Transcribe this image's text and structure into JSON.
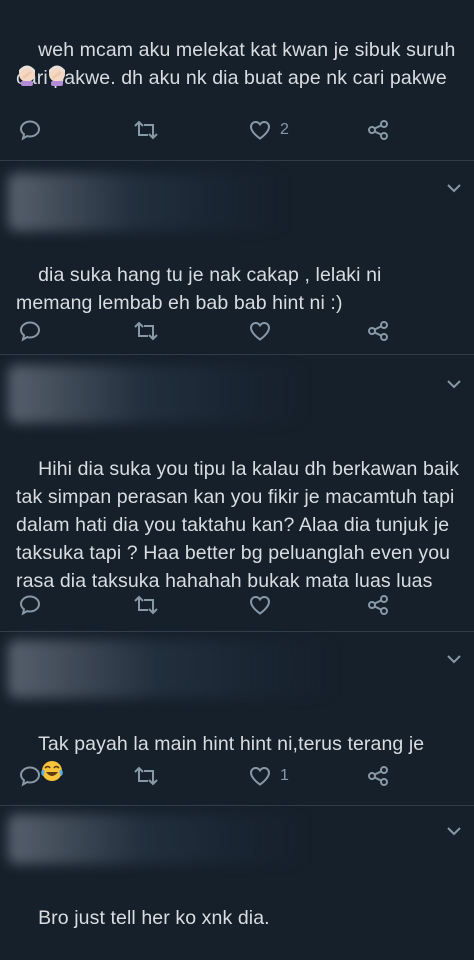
{
  "tweets": [
    {
      "text": "weh mcam aku melekat kat kwan je sibuk suruh cari pakwe. dh aku nk dia buat ape nk cari pakwe",
      "emoji": [
        "woman-facepalming",
        "woman-facepalming"
      ],
      "like_count": "2"
    },
    {
      "text": "dia suka hang tu je nak cakap , lelaki ni memang lembab eh bab bab hint ni :)",
      "like_count": ""
    },
    {
      "text": "Hihi dia suka you tipu la kalau dh berkawan baik tak simpan perasan kan you fikir je macamtuh tapi dalam hati dia you taktahu kan? Alaa dia tunjuk je taksuka tapi ? Haa better bg peluanglah even you rasa dia taksuka hahahah bukak mata luas luas",
      "like_count": ""
    },
    {
      "text": "Tak payah la main hint hint ni,terus terang je",
      "emoji": [
        "face-with-tears-of-joy"
      ],
      "like_count": "1"
    },
    {
      "text": "Bro just tell her ko xnk dia.",
      "like_count": ""
    }
  ],
  "icons": {
    "reply": "reply-icon",
    "retweet": "retweet-icon",
    "like": "heart-icon",
    "share": "share-icon",
    "more": "chevron-down-icon"
  },
  "colors": {
    "background": "#15202b",
    "text": "#d9dde1",
    "icon": "#8899a6",
    "divider": "#2f3d4a"
  }
}
